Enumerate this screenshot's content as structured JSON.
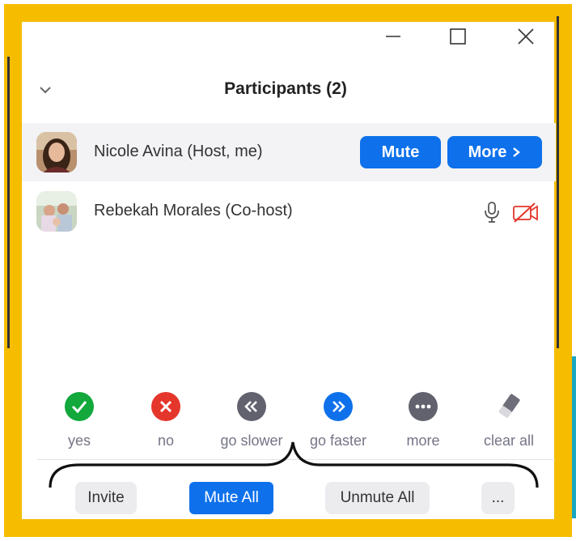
{
  "window": {
    "title": "Participants (2)",
    "controls": [
      "minimize-icon",
      "maximize-icon",
      "close-icon"
    ]
  },
  "participants": [
    {
      "name": "Nicole Avina (Host, me)",
      "actions": {
        "mute_label": "Mute",
        "more_label": "More"
      },
      "highlighted": true
    },
    {
      "name": "Rebekah Morales (Co-host)",
      "status_icons": [
        "microphone-icon",
        "video-off-icon"
      ]
    }
  ],
  "reactions": [
    {
      "label": "yes",
      "icon": "check-icon",
      "color": "#12a83c"
    },
    {
      "label": "no",
      "icon": "x-icon",
      "color": "#e5362c"
    },
    {
      "label": "go slower",
      "icon": "rewind-icon",
      "color": "#62626f"
    },
    {
      "label": "go faster",
      "icon": "fast-forward-icon",
      "color": "#0e71eb"
    },
    {
      "label": "more",
      "icon": "ellipsis-icon",
      "color": "#62626f"
    },
    {
      "label": "clear all",
      "icon": "eraser-icon",
      "color": "#6e6e7a"
    }
  ],
  "footer": {
    "invite_label": "Invite",
    "mute_all_label": "Mute All",
    "unmute_all_label": "Unmute All",
    "more_label": "..."
  },
  "colors": {
    "accent": "#0e71eb",
    "frame": "#f5bc00",
    "video_off": "#e5362c"
  }
}
